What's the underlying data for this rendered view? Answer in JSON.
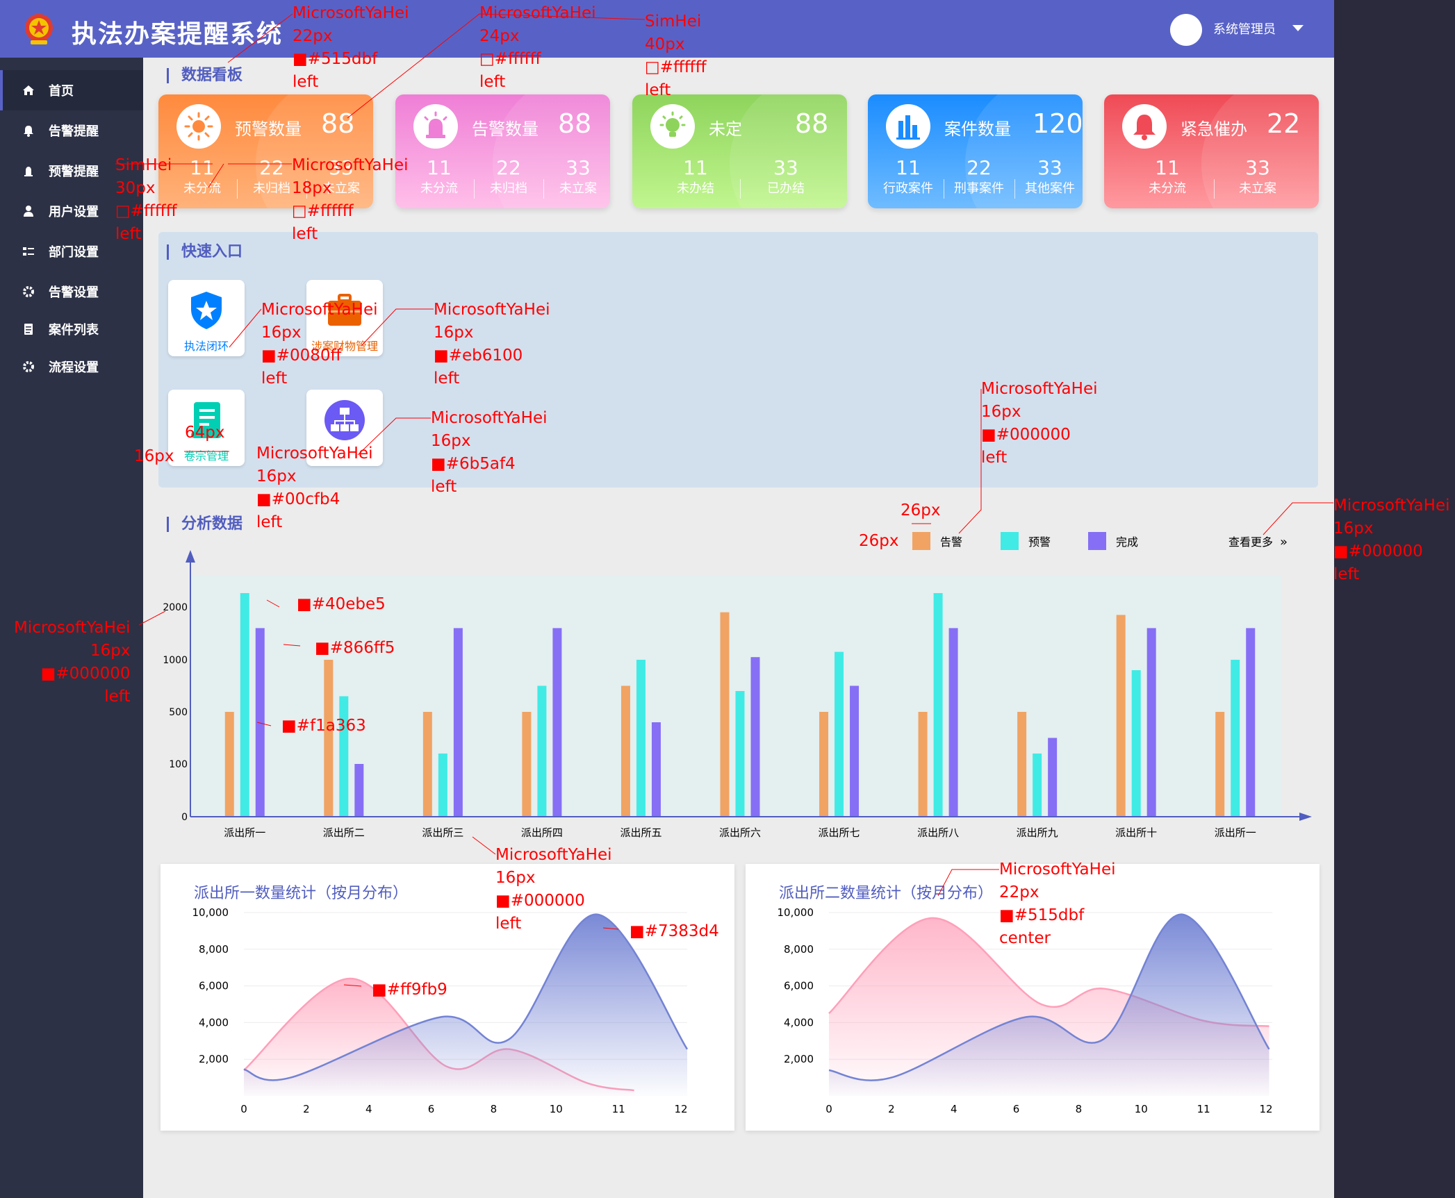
{
  "header": {
    "title": "执法办案提醒系统",
    "user": "系统管理员"
  },
  "sidebar": {
    "items": [
      {
        "label": "首页",
        "icon": "home-icon",
        "active": true
      },
      {
        "label": "告警提醒",
        "icon": "bell-icon"
      },
      {
        "label": "预警提醒",
        "icon": "alarm-icon"
      },
      {
        "label": "用户设置",
        "icon": "user-icon"
      },
      {
        "label": "部门设置",
        "icon": "department-icon"
      },
      {
        "label": "告警设置",
        "icon": "gear-icon"
      },
      {
        "label": "案件列表",
        "icon": "document-icon"
      },
      {
        "label": "流程设置",
        "icon": "gear-icon"
      }
    ]
  },
  "sections": {
    "dashboard": "数据看板",
    "quick": "快速入口",
    "analysis": "分析数据"
  },
  "cards": [
    {
      "label": "预警数量",
      "value": "88",
      "icon": "sun-icon",
      "colors": [
        "#ff8a3d",
        "#ffb27a"
      ],
      "subs": [
        {
          "v": "11",
          "l": "未分流"
        },
        {
          "v": "22",
          "l": "未归档"
        },
        {
          "v": "33",
          "l": "未立案"
        }
      ]
    },
    {
      "label": "告警数量",
      "value": "88",
      "icon": "siren-icon",
      "colors": [
        "#ef7ed6",
        "#ffbfe9"
      ],
      "subs": [
        {
          "v": "11",
          "l": "未分流"
        },
        {
          "v": "22",
          "l": "未归档"
        },
        {
          "v": "33",
          "l": "未立案"
        }
      ]
    },
    {
      "label": "未定",
      "value": "88",
      "icon": "bulb-icon",
      "colors": [
        "#8ed45c",
        "#c1f68f"
      ],
      "subs": [
        {
          "v": "11",
          "l": "未办结"
        },
        {
          "v": "33",
          "l": "已办结"
        }
      ]
    },
    {
      "label": "案件数量",
      "value": "120",
      "icon": "bar-chart-icon",
      "colors": [
        "#1a8cff",
        "#6fbcff"
      ],
      "subs": [
        {
          "v": "11",
          "l": "行政案件"
        },
        {
          "v": "22",
          "l": "刑事案件"
        },
        {
          "v": "33",
          "l": "其他案件"
        }
      ]
    },
    {
      "label": "紧急催办",
      "value": "22",
      "icon": "bell-icon",
      "colors": [
        "#ef4a55",
        "#ff9aa0"
      ],
      "subs": [
        {
          "v": "11",
          "l": "未分流"
        },
        {
          "v": "33",
          "l": "未立案"
        }
      ]
    }
  ],
  "quick": [
    {
      "label": "执法闭环",
      "color": "#0080ff",
      "icon": "police-badge-icon"
    },
    {
      "label": "涉案财物管理",
      "color": "#eb6100",
      "icon": "briefcase-icon"
    },
    {
      "label": "卷宗管理",
      "color": "#00cfb4",
      "icon": "scroll-icon"
    },
    {
      "label": "",
      "color": "#6b5af4",
      "icon": "org-chart-icon"
    }
  ],
  "legend_more": "查看更多",
  "chart_data": [
    {
      "type": "bar",
      "categories": [
        "派出所一",
        "派出所二",
        "派出所三",
        "派出所四",
        "派出所五",
        "派出所六",
        "派出所七",
        "派出所八",
        "派出所九",
        "派出所十",
        "派出所一"
      ],
      "y_ticks": [
        "0",
        "100",
        "500",
        "1000",
        "2000"
      ],
      "series": [
        {
          "name": "告警",
          "color": "#f1a363",
          "values": [
            500,
            1000,
            500,
            500,
            750,
            1900,
            500,
            500,
            500,
            1850,
            500
          ]
        },
        {
          "name": "预警",
          "color": "#40ebe5",
          "values": [
            2200,
            650,
            180,
            750,
            1000,
            700,
            1150,
            2200,
            180,
            900,
            1000
          ]
        },
        {
          "name": "完成",
          "color": "#866ff5",
          "values": [
            1600,
            100,
            1600,
            1600,
            420,
            1050,
            750,
            1600,
            300,
            1600,
            1600
          ]
        }
      ]
    },
    {
      "type": "area",
      "title": "派出所一数量统计（按月分布）",
      "x_ticks": [
        "0",
        "2",
        "4",
        "6",
        "8",
        "10",
        "11",
        "12"
      ],
      "y_ticks": [
        "2,000",
        "4,000",
        "6,000",
        "8,000",
        "10,000"
      ],
      "series": [
        {
          "color": "#ff9fb9",
          "x": [
            0,
            3.4,
            6.5,
            8.5,
            11,
            12.5
          ],
          "y": [
            1400,
            6400,
            1600,
            2550,
            700,
            300
          ]
        },
        {
          "color": "#7383d4",
          "x": [
            0,
            1.5,
            6.3,
            8.5,
            11.3,
            14.2
          ],
          "y": [
            1450,
            1000,
            4300,
            3100,
            9900,
            2550
          ]
        }
      ]
    },
    {
      "type": "area",
      "title": "派出所二数量统计（按月分布）",
      "x_ticks": [
        "0",
        "2",
        "4",
        "6",
        "8",
        "10",
        "11",
        "12"
      ],
      "y_ticks": [
        "2,000",
        "4,000",
        "6,000",
        "8,000",
        "10,000"
      ],
      "series": [
        {
          "color": "#ff9fb9",
          "x": [
            0,
            3.3,
            6.8,
            8.8,
            12,
            14.1
          ],
          "y": [
            4500,
            9700,
            5000,
            5850,
            4100,
            3800
          ]
        },
        {
          "color": "#7383d4",
          "x": [
            0,
            2,
            6.3,
            8.8,
            11.3,
            14.1
          ],
          "y": [
            1400,
            1000,
            4300,
            3100,
            9900,
            2550
          ]
        }
      ]
    }
  ],
  "annotations": [
    {
      "lines": [
        "MicrosoftYaHei",
        "22px",
        "■#515dbf",
        "left"
      ]
    },
    {
      "lines": [
        "MicrosoftYaHei",
        "24px",
        "□#ffffff",
        "left"
      ]
    },
    {
      "lines": [
        "SimHei",
        "40px",
        "□#ffffff",
        "left"
      ]
    },
    {
      "lines": [
        "SimHei",
        "30px",
        "□#ffffff",
        "left"
      ]
    },
    {
      "lines": [
        "MicrosoftYaHei",
        "18px",
        "□#ffffff",
        "left"
      ]
    },
    {
      "lines": [
        "MicrosoftYaHei",
        "16px",
        "■#0080ff",
        "left"
      ]
    },
    {
      "lines": [
        "MicrosoftYaHei",
        "16px",
        "■#eb6100",
        "left"
      ]
    },
    {
      "lines": [
        "MicrosoftYaHei",
        "16px",
        "■#000000",
        "left"
      ]
    },
    {
      "lines": [
        "MicrosoftYaHei",
        "16px",
        "■#6b5af4",
        "left"
      ]
    },
    {
      "lines": [
        "MicrosoftYaHei",
        "16px",
        "■#00cfb4",
        "left"
      ]
    },
    {
      "lines": [
        "MicrosoftYaHei",
        "16px",
        "■#000000",
        "left"
      ]
    },
    {
      "lines": [
        "MicrosoftYaHei",
        "16px",
        "■#000000",
        "left"
      ]
    },
    {
      "lines": [
        "MicrosoftYaHei",
        "16px",
        "■#000000",
        "left"
      ]
    },
    {
      "lines": [
        "MicrosoftYaHei",
        "22px",
        "■#515dbf",
        "center"
      ]
    },
    {
      "lines": [
        "64px"
      ]
    },
    {
      "lines": [
        "16px"
      ]
    },
    {
      "lines": [
        "26px"
      ]
    },
    {
      "lines": [
        "26px"
      ]
    },
    {
      "lines": [
        "■#40ebe5"
      ]
    },
    {
      "lines": [
        "■#866ff5"
      ]
    },
    {
      "lines": [
        "■#f1a363"
      ]
    },
    {
      "lines": [
        "■#ff9fb9"
      ]
    },
    {
      "lines": [
        "■#7383d4"
      ]
    }
  ]
}
